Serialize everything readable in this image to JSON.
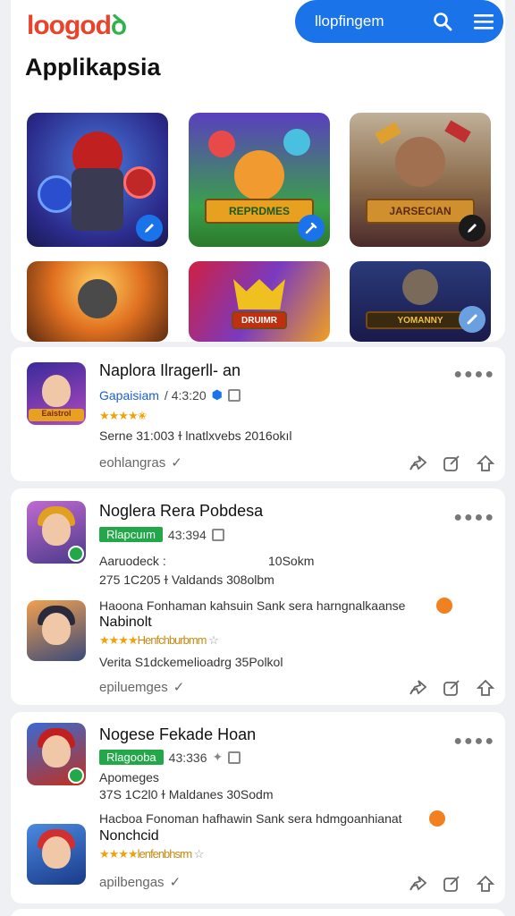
{
  "header": {
    "logo_part1": "loogod",
    "logo_part2": "ꝺ",
    "search_label": "llopfingem",
    "page_title": "Applikapsia"
  },
  "gallery": [
    {
      "label": "",
      "icon": "edit-icon"
    },
    {
      "label": "REPRDMES",
      "icon": "wrench-icon"
    },
    {
      "label": "JARSECIAN",
      "icon": "pencil-icon"
    },
    {
      "label": "",
      "icon": ""
    },
    {
      "label": "DRUIMR",
      "icon": ""
    },
    {
      "label": "YOMANNY",
      "icon": "link-icon"
    }
  ],
  "apps": [
    {
      "title": "Naplora Ilragerll- an",
      "developer": "Gapaisiam",
      "code": "/ 4:3:20",
      "stars": "★★★★✬",
      "desc": "Serne 31:003 ɫ lnatlxvebs 2016okıl",
      "tag": "eohlangras",
      "icon_label": "Eaistrol"
    },
    {
      "title": "Noglera Rera Pobdesa",
      "badge": "Rlapcuım",
      "code": "43:394",
      "sub1_left": "Aaruodeck :",
      "sub1_right": "10Sokm",
      "sub2": "275  1C205  ɫ  Valdands  308olbm",
      "promo": "Haoona Fonhaman kahsuin  Sank sera harngnalkaanse",
      "sub_title": "Nabinolt",
      "sub_stars": "★★★★",
      "sub_stars_label": "Henfchburbmm",
      "desc": "Verita S1dckemelioadrg 35Polkol",
      "tag": "epiluemges"
    },
    {
      "title": "Nogese Fekade Hoan",
      "badge": "Rlagooba",
      "code": "43:336",
      "sub1_left": "Apomeges",
      "sub2": "37S  1C2l0  ɫ  Maldanes  30Sodm",
      "promo": "Hacboa Fonoman hafhawin  Sank sera hdmgoanhianat",
      "sub_title": "Nonchcid",
      "sub_stars": "★★★★",
      "sub_stars_label": "lenfenbhsrm",
      "tag": "apilbengas"
    }
  ],
  "colors": {
    "accent": "#1a73e8",
    "badge_green": "#22a849",
    "star": "#f0a20a",
    "logo_red": "#e8432b",
    "logo_green": "#2fb24a"
  }
}
